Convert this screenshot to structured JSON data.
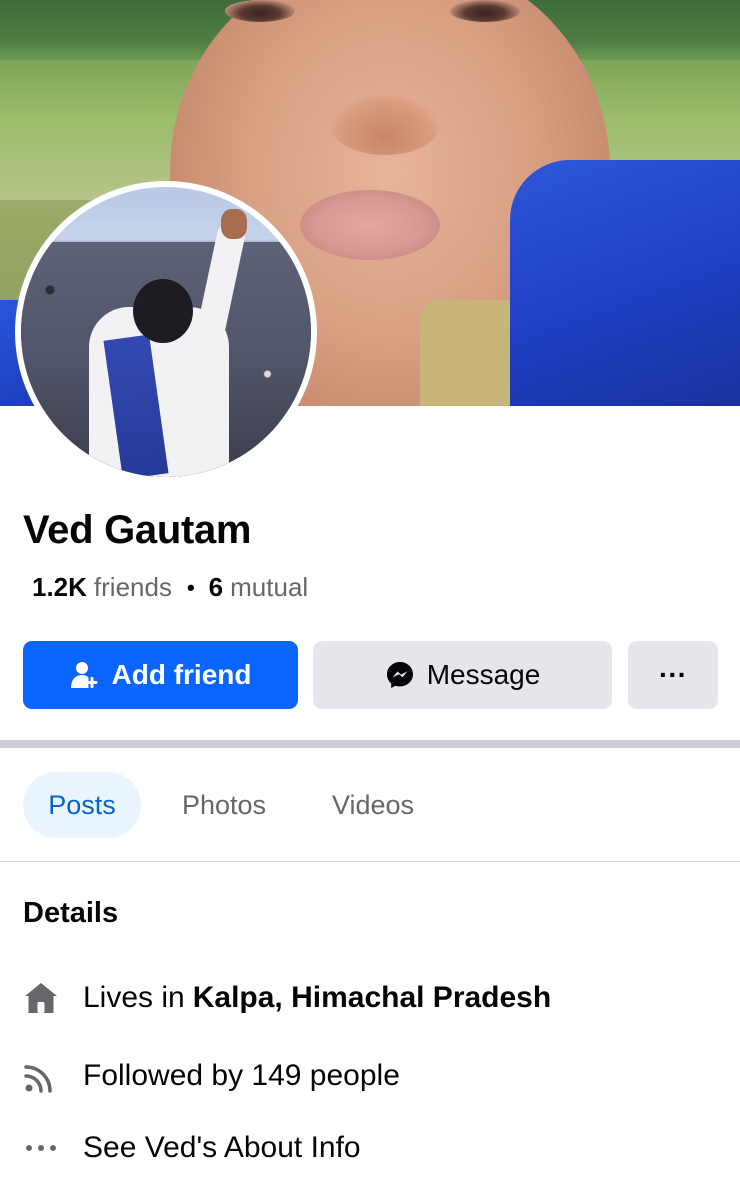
{
  "profile": {
    "name": "Ved Gautam",
    "friends_count": "1.2K",
    "friends_label": "friends",
    "separator": "•",
    "mutual_count": "6",
    "mutual_label": "mutual"
  },
  "actions": {
    "add_friend_label": "Add friend",
    "message_label": "Message",
    "more_label": "···"
  },
  "tabs": [
    {
      "label": "Posts",
      "active": true
    },
    {
      "label": "Photos",
      "active": false
    },
    {
      "label": "Videos",
      "active": false
    }
  ],
  "details": {
    "title": "Details",
    "lives_prefix": "Lives in",
    "lives_place": "Kalpa, Himachal Pradesh",
    "followed": "Followed by 149 people",
    "about": "See Ved's About Info"
  },
  "icons": {
    "add_friend": "person-plus-icon",
    "message": "messenger-icon",
    "more": "more-dots-icon",
    "home": "home-icon",
    "rss": "rss-icon",
    "dots": "dots-icon"
  },
  "colors": {
    "accent": "#0866ff",
    "tab_active_bg": "#ebf5ff",
    "tab_active_text": "#0064d1",
    "secondary_button": "#e4e6eb",
    "muted_text": "#65676b"
  }
}
